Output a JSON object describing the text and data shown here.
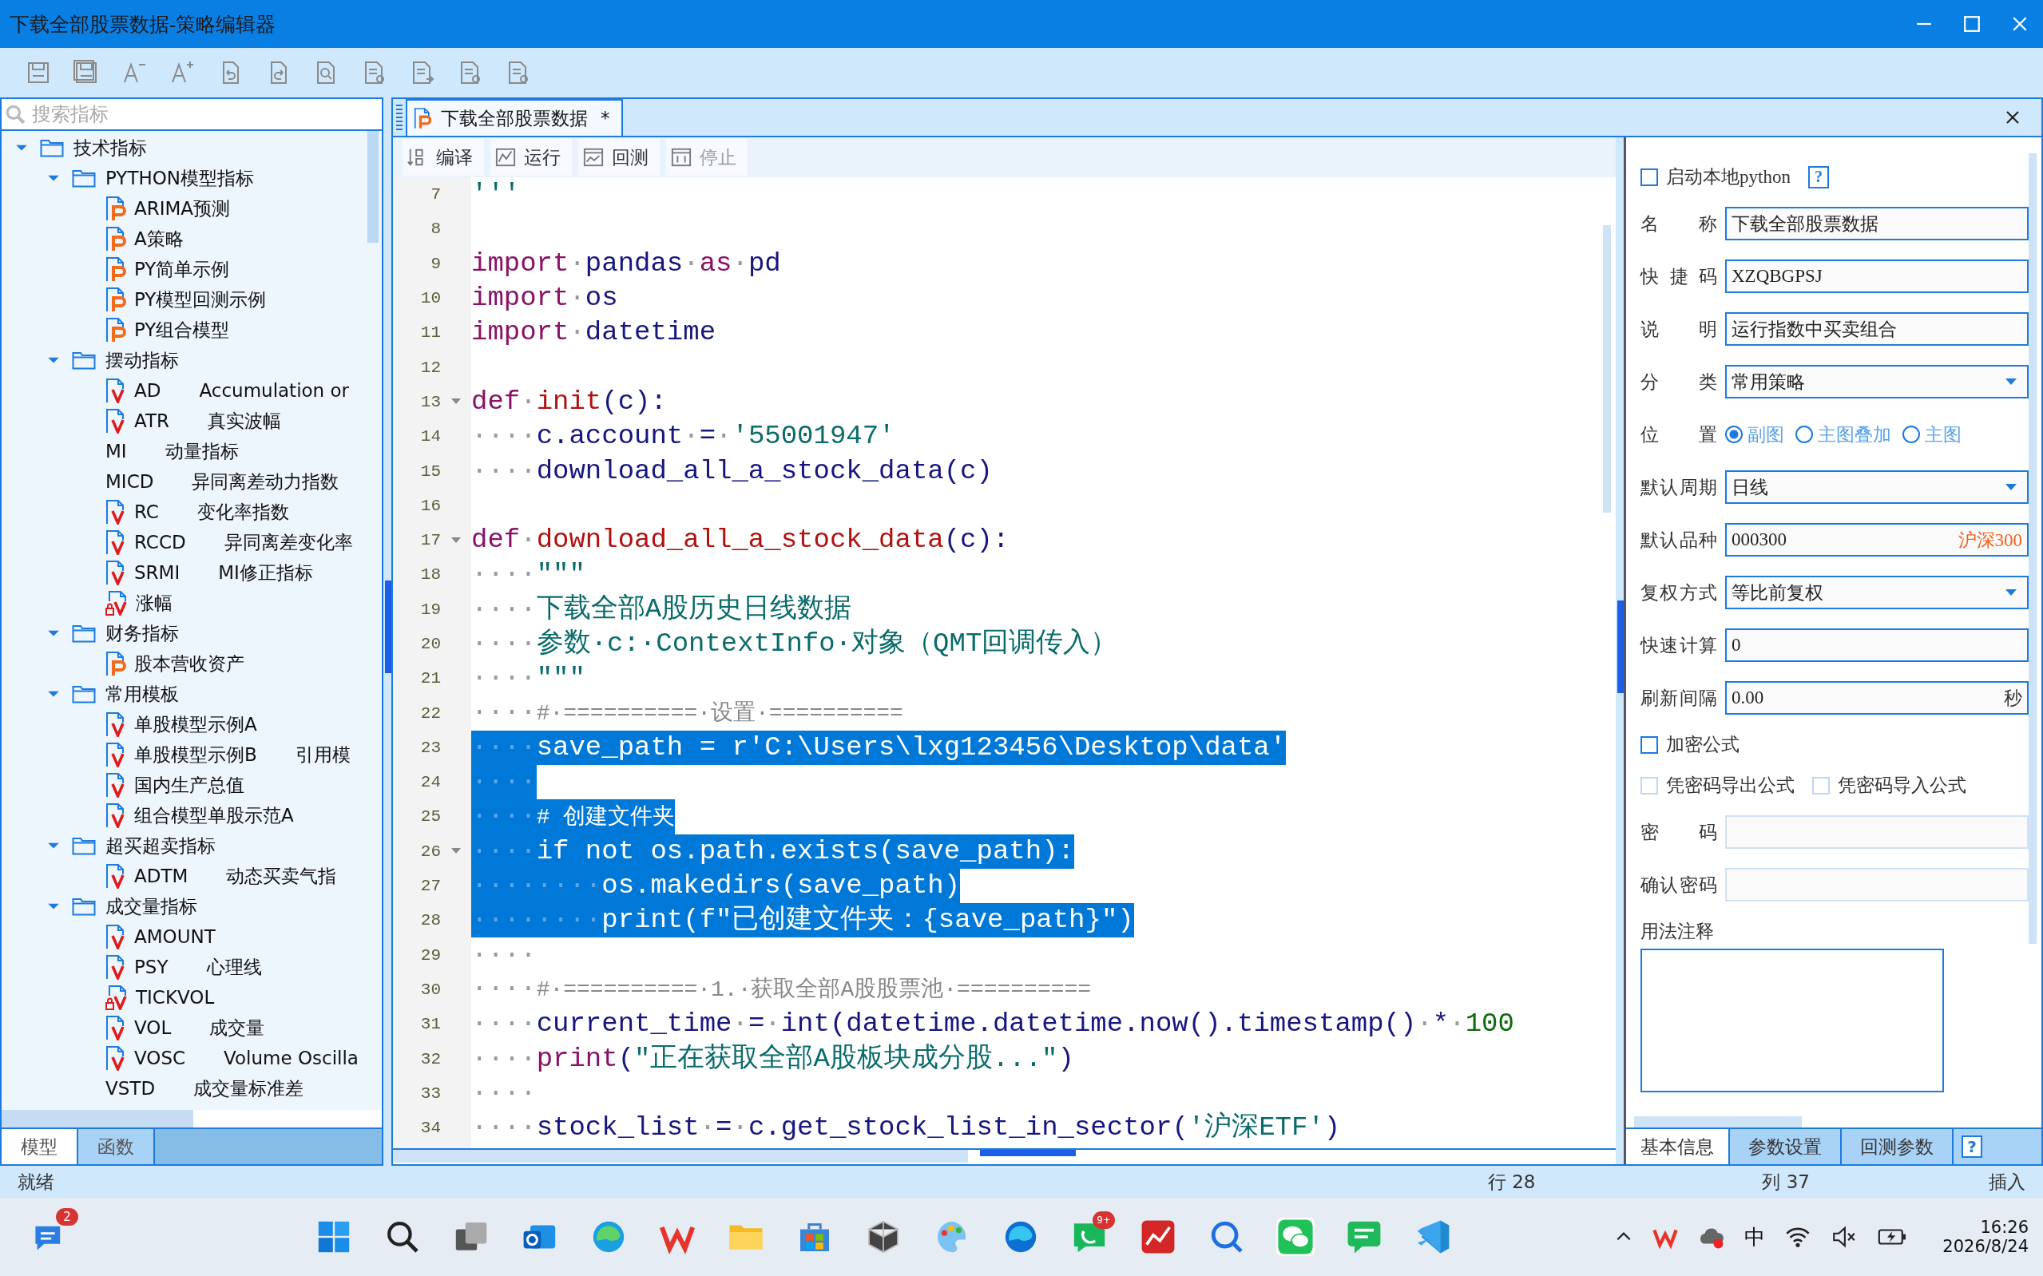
{
  "window": {
    "title": "下载全部股票数据-策略编辑器"
  },
  "sidebar": {
    "search": {
      "placeholder": "搜索指标"
    },
    "tree": [
      {
        "label": "技术指标",
        "expanded": true,
        "children": [
          {
            "label": "PYTHON模型指标",
            "expanded": true,
            "children": [
              {
                "label": "ARIMA预测",
                "kind": "p"
              },
              {
                "label": "A策略",
                "kind": "p"
              },
              {
                "label": "PY简单示例",
                "kind": "p"
              },
              {
                "label": "PY模型回测示例",
                "kind": "p"
              },
              {
                "label": "PY组合模型",
                "kind": "p"
              }
            ]
          },
          {
            "label": "摆动指标",
            "expanded": true,
            "children": [
              {
                "label": "AD",
                "description": "Accumulation or",
                "kind": "v"
              },
              {
                "label": "ATR",
                "description": "真实波幅",
                "kind": "v"
              },
              {
                "label": "MI",
                "description": "动量指标",
                "kind": "plain"
              },
              {
                "label": "MICD",
                "description": "异同离差动力指数",
                "kind": "plain"
              },
              {
                "label": "RC",
                "description": "变化率指数",
                "kind": "v"
              },
              {
                "label": "RCCD",
                "description": "异同离差变化率",
                "kind": "v"
              },
              {
                "label": "SRMI",
                "description": "MI修正指标",
                "kind": "v"
              },
              {
                "label": "涨幅",
                "kind": "locked"
              }
            ]
          },
          {
            "label": "财务指标",
            "expanded": true,
            "children": [
              {
                "label": "股本营收资产",
                "kind": "p"
              }
            ]
          },
          {
            "label": "常用模板",
            "expanded": true,
            "children": [
              {
                "label": "单股模型示例A",
                "kind": "v"
              },
              {
                "label": "单股模型示例B",
                "description": "引用模",
                "kind": "v"
              },
              {
                "label": "国内生产总值",
                "kind": "v"
              },
              {
                "label": "组合模型单股示范A",
                "kind": "v"
              }
            ]
          },
          {
            "label": "超买超卖指标",
            "expanded": true,
            "children": [
              {
                "label": "ADTM",
                "description": "动态买卖气指",
                "kind": "v"
              }
            ]
          },
          {
            "label": "成交量指标",
            "expanded": true,
            "children": [
              {
                "label": "AMOUNT",
                "kind": "v"
              },
              {
                "label": "PSY",
                "description": "心理线",
                "kind": "v"
              },
              {
                "label": "TICKVOL",
                "kind": "locked"
              },
              {
                "label": "VOL",
                "description": "成交量",
                "kind": "v"
              },
              {
                "label": "VOSC",
                "description": "Volume Oscilla",
                "kind": "v"
              },
              {
                "label": "VSTD",
                "description": "成交量标准差",
                "kind": "plain"
              }
            ]
          }
        ]
      }
    ],
    "tabs": [
      {
        "label": "模型",
        "selected": true
      },
      {
        "label": "函数",
        "selected": false
      }
    ]
  },
  "editor": {
    "tab": {
      "label": "下载全部股票数据",
      "modified_mark": "*"
    },
    "toolbar": [
      {
        "label": "编译",
        "disabled": false
      },
      {
        "label": "运行",
        "disabled": false
      },
      {
        "label": "回测",
        "disabled": false
      },
      {
        "label": "停止",
        "disabled": true
      }
    ],
    "lines": [
      {
        "number": "7",
        "fold": false,
        "selected": false,
        "segments": [
          {
            "kind": "string",
            "text": "'''"
          }
        ]
      },
      {
        "number": "8",
        "fold": false,
        "selected": false
      },
      {
        "number": "9",
        "fold": false,
        "selected": false,
        "segments": [
          {
            "kind": "keyword",
            "text": "import"
          },
          {
            "kind": "ws",
            "text": "·"
          },
          {
            "kind": "name",
            "text": "pandas"
          },
          {
            "kind": "ws",
            "text": "·"
          },
          {
            "kind": "keyword",
            "text": "as"
          },
          {
            "kind": "ws",
            "text": "·"
          },
          {
            "kind": "name",
            "text": "pd"
          }
        ]
      },
      {
        "number": "10",
        "fold": false,
        "selected": false,
        "segments": [
          {
            "kind": "keyword",
            "text": "import"
          },
          {
            "kind": "ws",
            "text": "·"
          },
          {
            "kind": "name",
            "text": "os"
          }
        ]
      },
      {
        "number": "11",
        "fold": false,
        "selected": false,
        "segments": [
          {
            "kind": "keyword",
            "text": "import"
          },
          {
            "kind": "ws",
            "text": "·"
          },
          {
            "kind": "name",
            "text": "datetime"
          }
        ]
      },
      {
        "number": "12",
        "fold": false,
        "selected": false
      },
      {
        "number": "13",
        "fold": true,
        "selected": false,
        "segments": [
          {
            "kind": "keyword",
            "text": "def"
          },
          {
            "kind": "ws",
            "text": "·"
          },
          {
            "kind": "function",
            "text": "init"
          },
          {
            "kind": "name",
            "text": "(c):"
          }
        ]
      },
      {
        "number": "14",
        "fold": false,
        "selected": false,
        "segments": [
          {
            "kind": "ws",
            "text": "····"
          },
          {
            "kind": "name",
            "text": "c.account"
          },
          {
            "kind": "ws",
            "text": "·"
          },
          {
            "kind": "name",
            "text": "="
          },
          {
            "kind": "ws",
            "text": "·"
          },
          {
            "kind": "string",
            "text": "'55001947'"
          }
        ]
      },
      {
        "number": "15",
        "fold": false,
        "selected": false,
        "segments": [
          {
            "kind": "ws",
            "text": "····"
          },
          {
            "kind": "name",
            "text": "download_all_a_stock_data(c)"
          }
        ]
      },
      {
        "number": "16",
        "fold": false,
        "selected": false
      },
      {
        "number": "17",
        "fold": true,
        "selected": false,
        "segments": [
          {
            "kind": "keyword",
            "text": "def"
          },
          {
            "kind": "ws",
            "text": "·"
          },
          {
            "kind": "function",
            "text": "download_all_a_stock_data"
          },
          {
            "kind": "name",
            "text": "(c):"
          }
        ]
      },
      {
        "number": "18",
        "fold": false,
        "selected": false,
        "segments": [
          {
            "kind": "ws",
            "text": "····"
          },
          {
            "kind": "string",
            "text": "\"\"\""
          }
        ]
      },
      {
        "number": "19",
        "fold": false,
        "selected": false,
        "segments": [
          {
            "kind": "ws",
            "text": "····"
          },
          {
            "kind": "string",
            "text": "下载全部A股历史日线数据"
          }
        ]
      },
      {
        "number": "20",
        "fold": false,
        "selected": false,
        "segments": [
          {
            "kind": "ws",
            "text": "····"
          },
          {
            "kind": "string",
            "text": "参数·c:·ContextInfo·对象（QMT回调传入）"
          }
        ]
      },
      {
        "number": "21",
        "fold": false,
        "selected": false,
        "segments": [
          {
            "kind": "ws",
            "text": "····"
          },
          {
            "kind": "string",
            "text": "\"\"\""
          }
        ]
      },
      {
        "number": "22",
        "fold": false,
        "selected": false,
        "segments": [
          {
            "kind": "ws",
            "text": "····"
          },
          {
            "kind": "comment",
            "text": "#·==========·设置·=========="
          }
        ]
      },
      {
        "number": "23",
        "fold": false,
        "selected": true,
        "segments": [
          {
            "kind": "ws",
            "text": "····"
          },
          {
            "kind": "name",
            "text": "save_path = r'C:\\Users\\lxg123456\\Desktop\\data'"
          }
        ]
      },
      {
        "number": "24",
        "fold": false,
        "selected": true,
        "segments": [
          {
            "kind": "ws",
            "text": "····"
          }
        ]
      },
      {
        "number": "25",
        "fold": false,
        "selected": true,
        "segments": [
          {
            "kind": "ws",
            "text": "····"
          },
          {
            "kind": "comment",
            "text": "# 创建文件夹"
          }
        ]
      },
      {
        "number": "26",
        "fold": true,
        "selected": true,
        "segments": [
          {
            "kind": "ws",
            "text": "····"
          },
          {
            "kind": "name",
            "text": "if not os.path.exists(save_path):"
          }
        ]
      },
      {
        "number": "27",
        "fold": false,
        "selected": true,
        "segments": [
          {
            "kind": "ws",
            "text": "········"
          },
          {
            "kind": "name",
            "text": "os.makedirs(save_path)"
          }
        ]
      },
      {
        "number": "28",
        "fold": false,
        "selected": true,
        "segments": [
          {
            "kind": "ws",
            "text": "········"
          },
          {
            "kind": "name",
            "text": "print(f\"已创建文件夹：{save_path}\")"
          }
        ]
      },
      {
        "number": "29",
        "fold": false,
        "selected": false,
        "segments": [
          {
            "kind": "ws",
            "text": "····"
          }
        ]
      },
      {
        "number": "30",
        "fold": false,
        "selected": false,
        "segments": [
          {
            "kind": "ws",
            "text": "····"
          },
          {
            "kind": "comment",
            "text": "#·==========·1.·获取全部A股股票池·=========="
          }
        ]
      },
      {
        "number": "31",
        "fold": false,
        "selected": false,
        "segments": [
          {
            "kind": "ws",
            "text": "····"
          },
          {
            "kind": "name",
            "text": "current_time"
          },
          {
            "kind": "ws",
            "text": "·"
          },
          {
            "kind": "name",
            "text": "="
          },
          {
            "kind": "ws",
            "text": "·"
          },
          {
            "kind": "name",
            "text": "int(datetime.datetime.now().timestamp()"
          },
          {
            "kind": "ws",
            "text": "·"
          },
          {
            "kind": "name",
            "text": "*"
          },
          {
            "kind": "ws",
            "text": "·"
          },
          {
            "kind": "number",
            "text": "100"
          }
        ]
      },
      {
        "number": "32",
        "fold": false,
        "selected": false,
        "segments": [
          {
            "kind": "ws",
            "text": "····"
          },
          {
            "kind": "keyword",
            "text": "print"
          },
          {
            "kind": "name",
            "text": "("
          },
          {
            "kind": "string",
            "text": "\"正在获取全部A股板块成分股...\""
          },
          {
            "kind": "name",
            "text": ")"
          }
        ]
      },
      {
        "number": "33",
        "fold": false,
        "selected": false,
        "segments": [
          {
            "kind": "ws",
            "text": "····"
          }
        ]
      },
      {
        "number": "34",
        "fold": false,
        "selected": false,
        "segments": [
          {
            "kind": "ws",
            "text": "····"
          },
          {
            "kind": "name",
            "text": "stock_list"
          },
          {
            "kind": "ws",
            "text": "·"
          },
          {
            "kind": "name",
            "text": "="
          },
          {
            "kind": "ws",
            "text": "·"
          },
          {
            "kind": "name",
            "text": "c.get_stock_list_in_sector("
          },
          {
            "kind": "string",
            "text": "'沪深ETF'"
          },
          {
            "kind": "name",
            "text": ")"
          }
        ]
      }
    ]
  },
  "properties": {
    "local_python": {
      "label": "启动本地python",
      "checked": false,
      "help": "?"
    },
    "fields": [
      {
        "kind": "text",
        "label": "名称",
        "value": "下载全部股票数据",
        "disabled": false
      },
      {
        "kind": "text",
        "label": "快捷码",
        "value": "XZQBGPSJ",
        "disabled": false
      },
      {
        "kind": "text",
        "label": "说明",
        "value": "运行指数中买卖组合",
        "disabled": false
      },
      {
        "kind": "select",
        "label": "分类",
        "value": "常用策略"
      },
      {
        "kind": "radio",
        "label": "位置",
        "options": [
          {
            "label": "副图",
            "selected": true
          },
          {
            "label": "主图叠加",
            "selected": false
          },
          {
            "label": "主图",
            "selected": false
          }
        ]
      },
      {
        "kind": "select",
        "label": "默认周期",
        "value": "日线"
      },
      {
        "kind": "text",
        "label": "默认品种",
        "value": "000300",
        "disabled": false,
        "suffix": {
          "text": "沪深300",
          "kind": "name"
        }
      },
      {
        "kind": "select",
        "label": "复权方式",
        "value": "等比前复权"
      },
      {
        "kind": "text",
        "label": "快速计算",
        "value": "0",
        "disabled": false
      },
      {
        "kind": "text",
        "label": "刷新间隔",
        "value": "0.00",
        "disabled": false,
        "suffix": {
          "text": "秒",
          "kind": "unit"
        }
      },
      {
        "kind": "checkbox",
        "items": [
          {
            "label": "加密公式",
            "checked": false,
            "disabled": false
          }
        ]
      },
      {
        "kind": "checkbox",
        "items": [
          {
            "label": "凭密码导出公式",
            "checked": false,
            "disabled": true
          },
          {
            "label": "凭密码导入公式",
            "checked": false,
            "disabled": true
          }
        ]
      },
      {
        "kind": "text",
        "label": "密码",
        "disabled": true
      },
      {
        "kind": "text",
        "label": "确认密码",
        "disabled": true
      },
      {
        "kind": "textarea",
        "label": "用法注释"
      }
    ],
    "tabs": [
      {
        "label": "基本信息",
        "selected": true
      },
      {
        "label": "参数设置",
        "selected": false
      },
      {
        "label": "回测参数",
        "selected": false
      }
    ],
    "help": "?"
  },
  "status_bar": {
    "status": "就绪",
    "line": "行 28",
    "column": "列 37",
    "mode": "插入"
  },
  "taskbar": {
    "chat_badge": "2",
    "phone_badge": "9+",
    "input_method": "中",
    "time": "16:26",
    "date": "2026/8/24"
  }
}
